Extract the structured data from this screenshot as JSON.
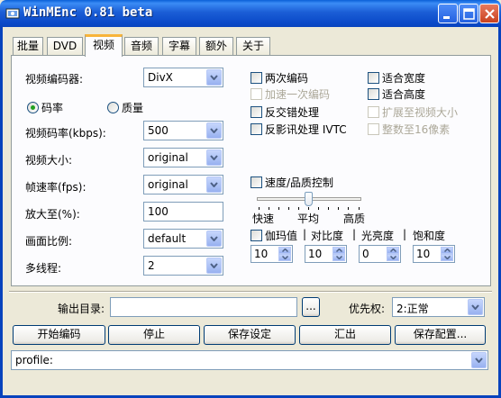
{
  "window": {
    "title": "WinMEnc 0.81 beta",
    "minimize_glyph": "_",
    "maximize_glyph": "□",
    "close_glyph": "×"
  },
  "tabs": [
    {
      "label": "批量"
    },
    {
      "label": "DVD"
    },
    {
      "label": "视频"
    },
    {
      "label": "音频"
    },
    {
      "label": "字幕"
    },
    {
      "label": "额外"
    },
    {
      "label": "关于"
    }
  ],
  "active_tab": "视频",
  "video": {
    "encoder_label": "视频编码器:",
    "encoder_value": "DivX",
    "rate_mode": {
      "bitrate_label": "码率",
      "quality_label": "质量",
      "selected": "码率"
    },
    "bitrate_label": "视频码率(kbps):",
    "bitrate_value": "500",
    "size_label": "视频大小:",
    "size_value": "original",
    "fps_label": "帧速率(fps):",
    "fps_value": "original",
    "zoom_label": "放大至(%):",
    "zoom_value": "100",
    "aspect_label": "画面比例:",
    "aspect_value": "default",
    "threads_label": "多线程:",
    "threads_value": "2"
  },
  "options": {
    "two_pass": {
      "label": "两次编码",
      "checked": false
    },
    "fast_first_pass": {
      "label": "加速一次编码",
      "checked": false,
      "disabled": true
    },
    "deinterlace": {
      "label": "反交错处理",
      "checked": false
    },
    "ivtc": {
      "label": "反影讯处理 IVTC",
      "checked": false
    },
    "fit_width": {
      "label": "适合宽度",
      "checked": false
    },
    "fit_height": {
      "label": "适合高度",
      "checked": false
    },
    "expand_to_size": {
      "label": "扩展至视频大小",
      "checked": false,
      "disabled": true
    },
    "round_16": {
      "label": "整数至16像素",
      "checked": false,
      "disabled": true
    }
  },
  "speed_quality": {
    "label": "速度/品质控制",
    "checked": false,
    "level": 0.5,
    "marks": [
      "快速",
      "平均",
      "高质"
    ]
  },
  "adjust": {
    "gamma_label": "伽玛值",
    "contrast_label": "对比度",
    "brightness_label": "光亮度",
    "saturation_label": "饱和度",
    "separator": "|",
    "checked": false,
    "gamma_value": "10",
    "contrast_value": "10",
    "brightness_value": "0",
    "saturation_value": "10"
  },
  "output": {
    "dir_label": "输出目录:",
    "dir_value": "",
    "browse_label": "...",
    "priority_label": "优先权:",
    "priority_value": "2:正常"
  },
  "buttons": {
    "start": "开始编码",
    "stop": "停止",
    "save_settings": "保存设定",
    "export": "汇出",
    "save_config": "保存配置..."
  },
  "profile": {
    "value": "profile:"
  }
}
